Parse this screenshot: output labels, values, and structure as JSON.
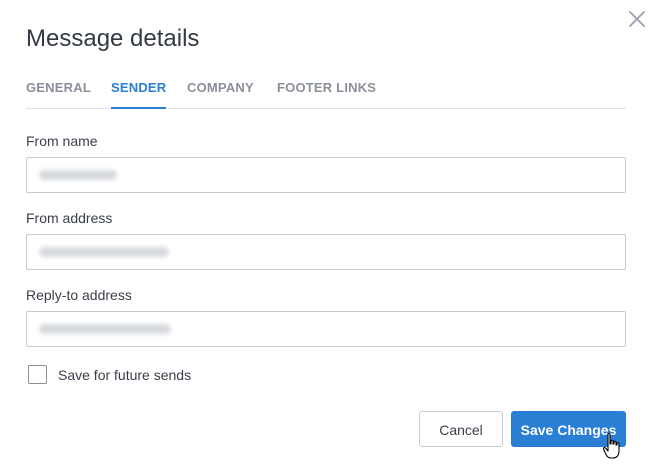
{
  "dialog": {
    "title": "Message details",
    "close_icon": "close-icon"
  },
  "tabs": [
    {
      "label": "GENERAL",
      "active": false
    },
    {
      "label": "SENDER",
      "active": true
    },
    {
      "label": "COMPANY",
      "active": false
    },
    {
      "label": "FOOTER LINKS",
      "active": false
    }
  ],
  "form": {
    "from_name": {
      "label": "From name",
      "value_redacted": true
    },
    "from_address": {
      "label": "From address",
      "value_redacted": true
    },
    "reply_to_address": {
      "label": "Reply-to address",
      "value_redacted": true
    },
    "save_future": {
      "label": "Save for future sends",
      "checked": false
    }
  },
  "actions": {
    "cancel_label": "Cancel",
    "save_label": "Save Changes"
  },
  "colors": {
    "accent": "#2a7fd4",
    "text": "#3a3f4a",
    "muted": "#8a9099",
    "border": "#c7cbd1"
  }
}
